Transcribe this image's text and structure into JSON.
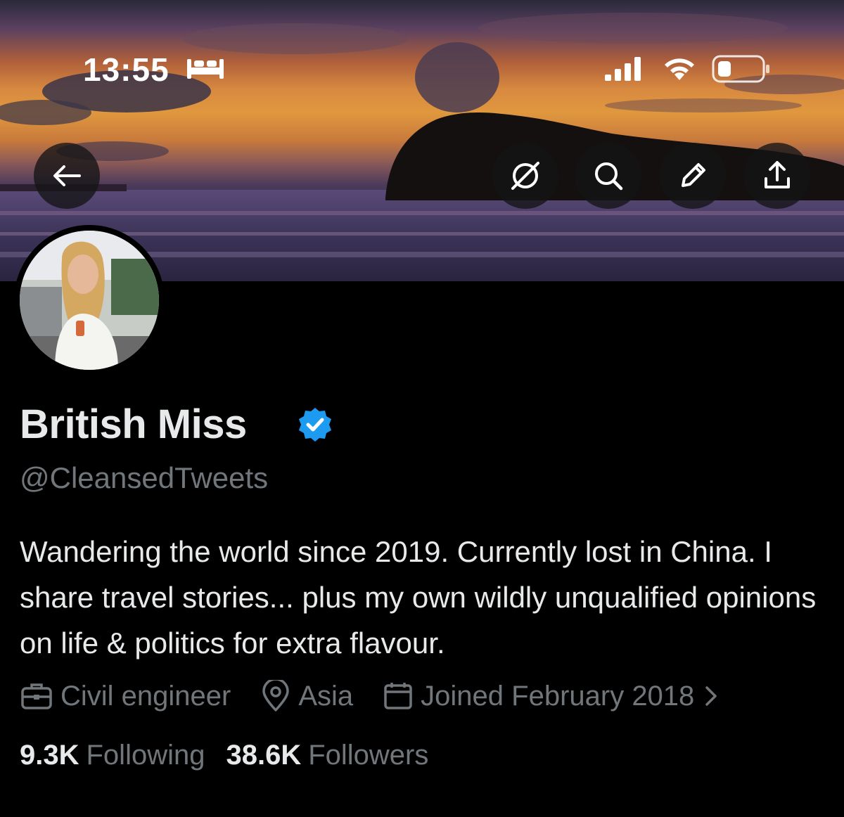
{
  "status_bar": {
    "time": "13:55",
    "sleep_icon": "bed-icon",
    "signal_icon": "cellular-signal-icon",
    "wifi_icon": "wifi-icon",
    "battery_icon": "battery-icon"
  },
  "header": {
    "back_icon": "arrow-left-icon",
    "actions": [
      "grok-icon",
      "search-icon",
      "pencil-icon",
      "share-icon"
    ]
  },
  "profile": {
    "display_name": "British Miss",
    "verified": true,
    "handle": "@CleansedTweets",
    "bio": "Wandering the world since 2019. Currently lost in China. I share travel stories... plus my own wildly unqualified opinions on life & politics for extra flavour.",
    "profession": "Civil engineer",
    "location": "Asia",
    "joined": "Joined February 2018",
    "following_count": "9.3K",
    "following_label": "Following",
    "followers_count": "38.6K",
    "followers_label": "Followers"
  },
  "colors": {
    "background": "#000000",
    "primary_text": "#e7e9ea",
    "secondary_text": "#71767b",
    "verified_blue": "#1d9bf0"
  }
}
